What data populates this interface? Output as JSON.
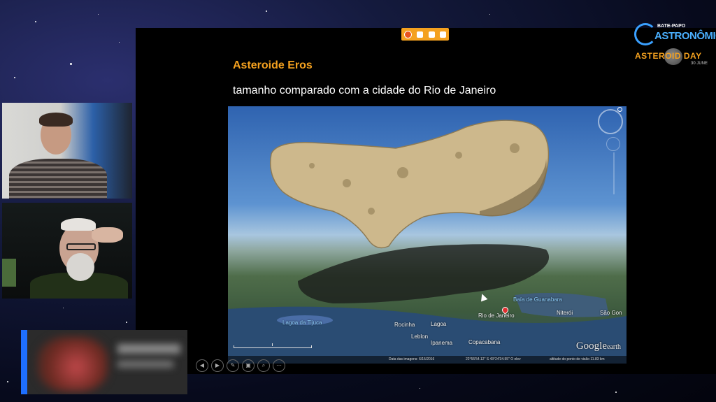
{
  "slide": {
    "title": "Asteroide Eros",
    "subtitle": "tamanho comparado com a cidade do Rio de Janeiro"
  },
  "presenter_toolbar": {
    "icons": [
      "firefox-icon",
      "camera-icon",
      "microphone-icon",
      "share-icon"
    ]
  },
  "logo": {
    "line1": "BATE-PAPO",
    "line2": "ASTRONÔMICO",
    "event": "ASTEROID DAY",
    "event_date": "30 JUNE"
  },
  "map": {
    "labels": {
      "baia": "Baía de Guanabara",
      "niteroi": "Niterói",
      "sao_goncalo": "São Gon",
      "rio": "Rio de Janeiro",
      "lagoa_jacarepagua": "Lagoa da Tijuca",
      "rocinha": "Rocinha",
      "lagoa": "Lagoa",
      "leblon": "Leblon",
      "ipanema": "Ipanema",
      "copacabana": "Copacabana"
    },
    "logo_text": "Google",
    "logo_suffix": "earth",
    "footer_date": "Data das imagens: 6/15/2016",
    "footer_coords": "22°55'54.12\" S  43°24'34.55\" O  elev",
    "footer_alt": "altitude do ponto de visão  11.83 km"
  },
  "slide_controls": [
    "◀",
    "▶",
    "✎",
    "▣",
    "⌕",
    "⋯"
  ],
  "colors": {
    "accent": "#f4a11f",
    "participant_accent": "#1e6fff"
  }
}
